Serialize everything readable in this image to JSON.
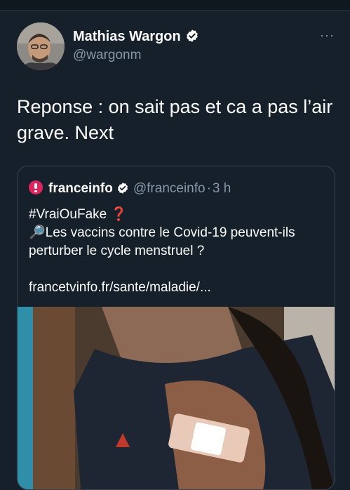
{
  "tweet": {
    "author_name": "Mathias Wargon",
    "author_handle": "@wargonm",
    "more_label": "···",
    "text": "Reponse : on sait pas et ca a pas l’air grave. Next"
  },
  "quoted_tweet": {
    "author_name": "franceinfo",
    "author_handle": "@franceinfo",
    "separator": "·",
    "time_ago": "3 h",
    "hashtag": "#VraiOuFake",
    "hashtag_emoji": "❓",
    "lead_emoji": "🔎",
    "body": "Les vaccins contre le Covid-19 peuvent-ils perturber le cycle menstruel ?",
    "link": "francetvinfo.fr/sante/maladie/..."
  },
  "colors": {
    "background": "#15202b",
    "secondary_text": "#8899a6",
    "verified_badge": "#ffffff",
    "franceinfo_brand": "#e0245e"
  }
}
